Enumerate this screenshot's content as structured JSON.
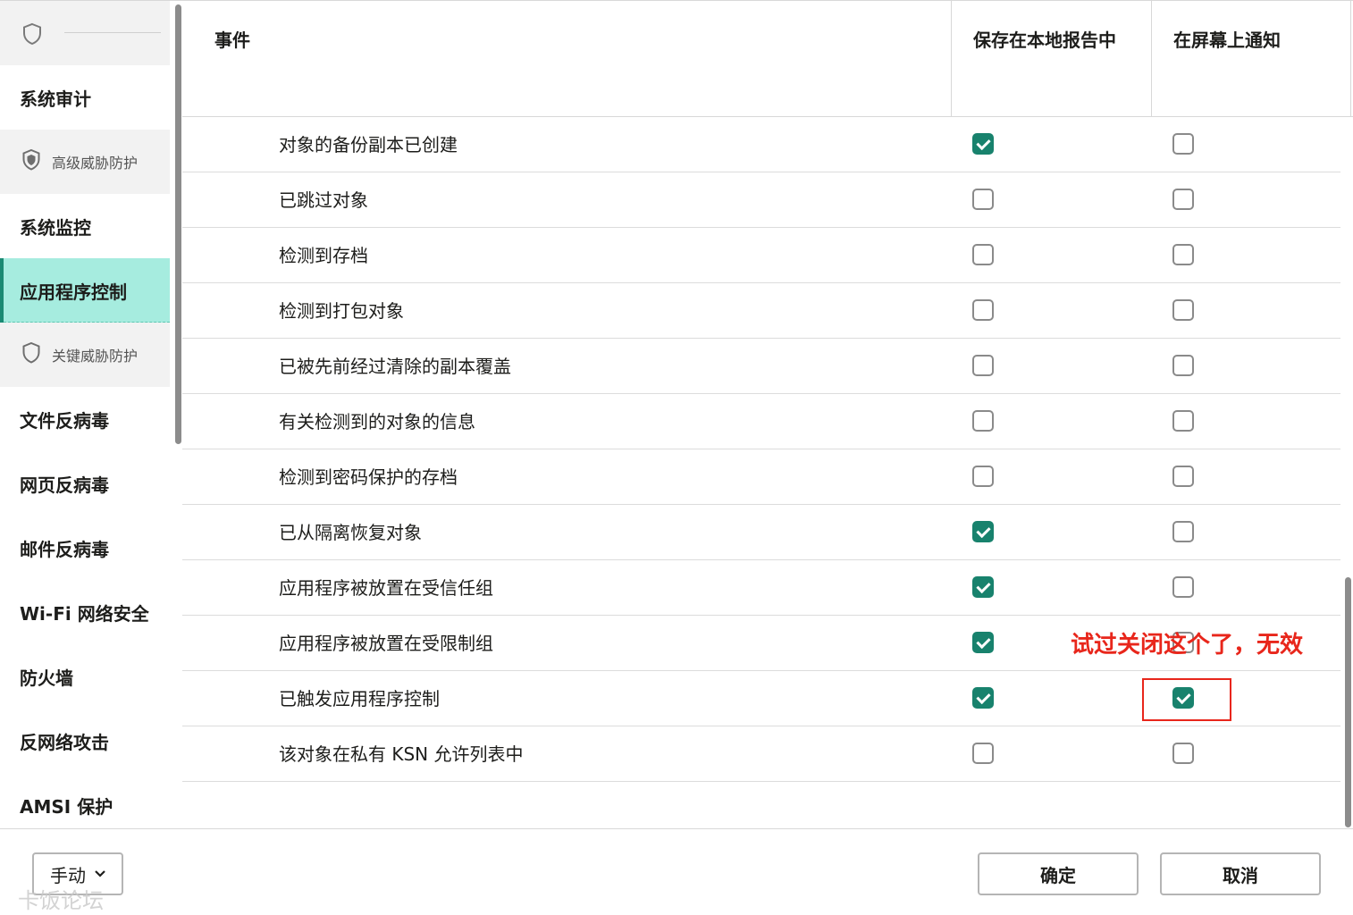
{
  "sidebar": {
    "items": [
      {
        "label": "系统审计",
        "type": "item"
      },
      {
        "label": "高级威胁防护",
        "type": "section"
      },
      {
        "label": "系统监控",
        "type": "item"
      },
      {
        "label": "应用程序控制",
        "type": "item",
        "active": true
      },
      {
        "label": "关键威胁防护",
        "type": "section"
      },
      {
        "label": "文件反病毒",
        "type": "item"
      },
      {
        "label": "网页反病毒",
        "type": "item"
      },
      {
        "label": "邮件反病毒",
        "type": "item"
      },
      {
        "label": "Wi-Fi 网络安全",
        "type": "item"
      },
      {
        "label": "防火墙",
        "type": "item"
      },
      {
        "label": "反网络攻击",
        "type": "item"
      },
      {
        "label": "AMSI 保护",
        "type": "item"
      }
    ]
  },
  "table": {
    "headers": {
      "event": "事件",
      "save_local": "保存在本地报告中",
      "notify_screen": "在屏幕上通知"
    },
    "rows": [
      {
        "event": "对象的备份副本已创建",
        "save_local": true,
        "notify_screen": false
      },
      {
        "event": "已跳过对象",
        "save_local": false,
        "notify_screen": false
      },
      {
        "event": "检测到存档",
        "save_local": false,
        "notify_screen": false
      },
      {
        "event": "检测到打包对象",
        "save_local": false,
        "notify_screen": false
      },
      {
        "event": "已被先前经过清除的副本覆盖",
        "save_local": false,
        "notify_screen": false
      },
      {
        "event": "有关检测到的对象的信息",
        "save_local": false,
        "notify_screen": false
      },
      {
        "event": "检测到密码保护的存档",
        "save_local": false,
        "notify_screen": false
      },
      {
        "event": "已从隔离恢复对象",
        "save_local": true,
        "notify_screen": false
      },
      {
        "event": "应用程序被放置在受信任组",
        "save_local": true,
        "notify_screen": false
      },
      {
        "event": "应用程序被放置在受限制组",
        "save_local": true,
        "notify_screen": false
      },
      {
        "event": "已触发应用程序控制",
        "save_local": true,
        "notify_screen": true
      },
      {
        "event": "该对象在私有 KSN 允许列表中",
        "save_local": false,
        "notify_screen": false
      }
    ]
  },
  "annotation": {
    "text": "试过关闭这个了，无效",
    "color": "#e8261b"
  },
  "footer": {
    "mode_label": "手动",
    "ok_label": "确定",
    "cancel_label": "取消",
    "watermark": "卡饭论坛"
  },
  "colors": {
    "accent": "#18826d",
    "active_bg": "#a6ecdf"
  }
}
